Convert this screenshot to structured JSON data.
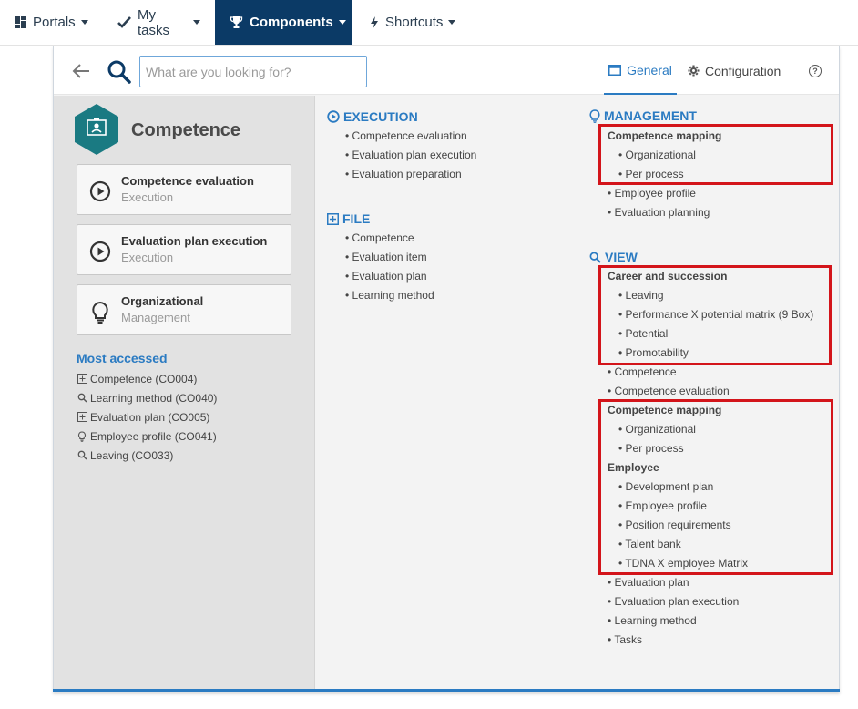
{
  "nav": {
    "portals": "Portals",
    "my_tasks": "My tasks",
    "components": "Components",
    "shortcuts": "Shortcuts"
  },
  "search": {
    "placeholder": "What are you looking for?"
  },
  "tabs": {
    "general": "General",
    "configuration": "Configuration",
    "help": "?"
  },
  "component": {
    "title": "Competence",
    "cards": [
      {
        "title": "Competence evaluation",
        "subtitle": "Execution",
        "icon": "play-circle-icon"
      },
      {
        "title": "Evaluation plan execution",
        "subtitle": "Execution",
        "icon": "play-circle-icon"
      },
      {
        "title": "Organizational",
        "subtitle": "Management",
        "icon": "lightbulb-icon"
      }
    ],
    "most_accessed_title": "Most accessed",
    "most_accessed": [
      {
        "label": "Competence (CO004)",
        "icon": "plus-square-icon"
      },
      {
        "label": "Learning method (CO040)",
        "icon": "search-icon"
      },
      {
        "label": "Evaluation plan (CO005)",
        "icon": "plus-square-icon"
      },
      {
        "label": "Employee profile (CO041)",
        "icon": "lightbulb-icon"
      },
      {
        "label": "Leaving (CO033)",
        "icon": "search-icon"
      }
    ]
  },
  "execution": {
    "title": "EXECUTION",
    "items": [
      "Competence evaluation",
      "Evaluation plan execution",
      "Evaluation preparation"
    ]
  },
  "file": {
    "title": "FILE",
    "items": [
      "Competence",
      "Evaluation item",
      "Evaluation plan",
      "Learning method"
    ]
  },
  "management": {
    "title": "MANAGEMENT",
    "group_competence_mapping": "Competence mapping",
    "cm_items": [
      "Organizational",
      "Per process"
    ],
    "items": [
      "Employee profile",
      "Evaluation planning"
    ]
  },
  "view": {
    "title": "VIEW",
    "group_career": "Career and succession",
    "career_items": [
      "Leaving",
      "Performance X potential matrix (9 Box)",
      "Potential",
      "Promotability"
    ],
    "items_mid": [
      "Competence",
      "Competence evaluation"
    ],
    "group_competence_mapping": "Competence mapping",
    "cm_items": [
      "Organizational",
      "Per process"
    ],
    "group_employee": "Employee",
    "employee_items": [
      "Development plan",
      "Employee profile",
      "Position requirements",
      "Talent bank",
      "TDNA X employee Matrix"
    ],
    "items_end": [
      "Evaluation plan",
      "Evaluation plan execution",
      "Learning method",
      "Tasks"
    ]
  },
  "colors": {
    "accent": "#2b7bc2",
    "nav_active": "#0b3a66",
    "highlight": "#d3141a",
    "hex": "#1a7a82"
  }
}
